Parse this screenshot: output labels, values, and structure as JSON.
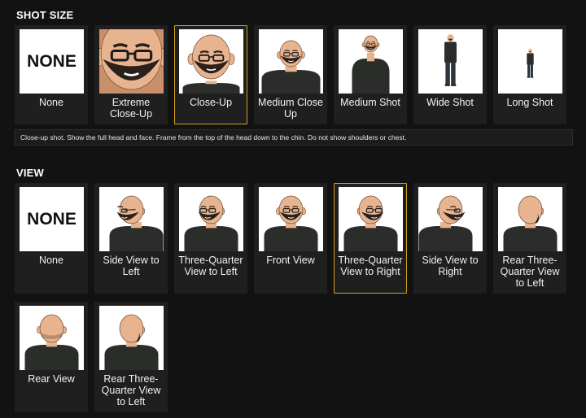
{
  "shot_size": {
    "title": "SHOT SIZE",
    "items": [
      {
        "label": "None",
        "thumb": "none",
        "selected": false
      },
      {
        "label": "Extreme Close-Up",
        "thumb": "extreme-close-up",
        "selected": false
      },
      {
        "label": "Close-Up",
        "thumb": "close-up",
        "selected": true
      },
      {
        "label": "Medium Close Up",
        "thumb": "medium-close-up",
        "selected": false
      },
      {
        "label": "Medium Shot",
        "thumb": "medium-shot",
        "selected": false
      },
      {
        "label": "Wide Shot",
        "thumb": "wide-shot",
        "selected": false
      },
      {
        "label": "Long Shot",
        "thumb": "long-shot",
        "selected": false
      }
    ],
    "description": "Close-up shot. Show the full head and face. Frame from the top of the head down to the chin. Do not show shoulders or chest."
  },
  "view": {
    "title": "VIEW",
    "items": [
      {
        "label": "None",
        "thumb": "none",
        "selected": false
      },
      {
        "label": "Side View to Left",
        "thumb": "side-left",
        "selected": false
      },
      {
        "label": "Three-Quarter View to Left",
        "thumb": "tq-left",
        "selected": false
      },
      {
        "label": "Front View",
        "thumb": "front",
        "selected": false
      },
      {
        "label": "Three-Quarter View to Right",
        "thumb": "tq-right",
        "selected": true
      },
      {
        "label": "Side View to Right",
        "thumb": "side-right",
        "selected": false
      },
      {
        "label": "Rear Three-Quarter View to Left",
        "thumb": "rear-tq-left",
        "selected": false
      },
      {
        "label": "Rear View",
        "thumb": "rear",
        "selected": false
      },
      {
        "label": "Rear Three-Quarter View to Left",
        "thumb": "rear-tq-left-2",
        "selected": false
      }
    ]
  },
  "none_thumb_text": "NONE",
  "colors": {
    "background": "#121212",
    "card": "#1f1f1f",
    "selected_border": "#d4a017",
    "skin": "#e8b48f",
    "shirt": "#2a2d29",
    "beard": "#2b211b"
  }
}
